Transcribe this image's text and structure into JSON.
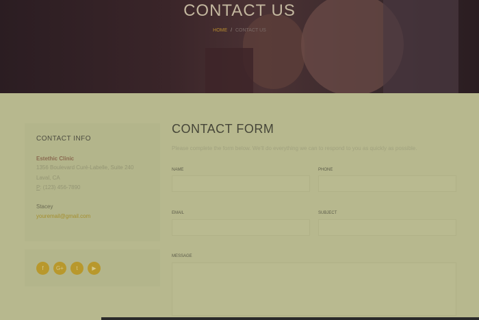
{
  "hero": {
    "title": "CONTACT US",
    "breadcrumb": {
      "home": "HOME",
      "separator": "/",
      "current": "CONTACT US"
    }
  },
  "contact_info": {
    "title": "CONTACT INFO",
    "clinic": "Estethic Clinic",
    "address": "1356 Boulevard Curé-Labelle, Suite 240",
    "city": "Laval, CA",
    "phone_label": "P",
    "phone": ": (123) 456-7890",
    "person": "Stacey",
    "email": "youremail@gmail.com"
  },
  "social": {
    "facebook": "f",
    "google": "G+",
    "twitter": "t",
    "youtube": "▶"
  },
  "form": {
    "title": "CONTACT FORM",
    "description": "Please complete the form below. We'll do everything we can to respond to you as quickly as possible.",
    "name_label": "NAME",
    "phone_label": "PHONE",
    "email_label": "EMAIL",
    "subject_label": "SUBJECT",
    "message_label": "MESSAGE"
  },
  "colors": {
    "accent": "#b8982c",
    "page_background": "#b7b88e",
    "hero_text": "#c3b79f"
  }
}
